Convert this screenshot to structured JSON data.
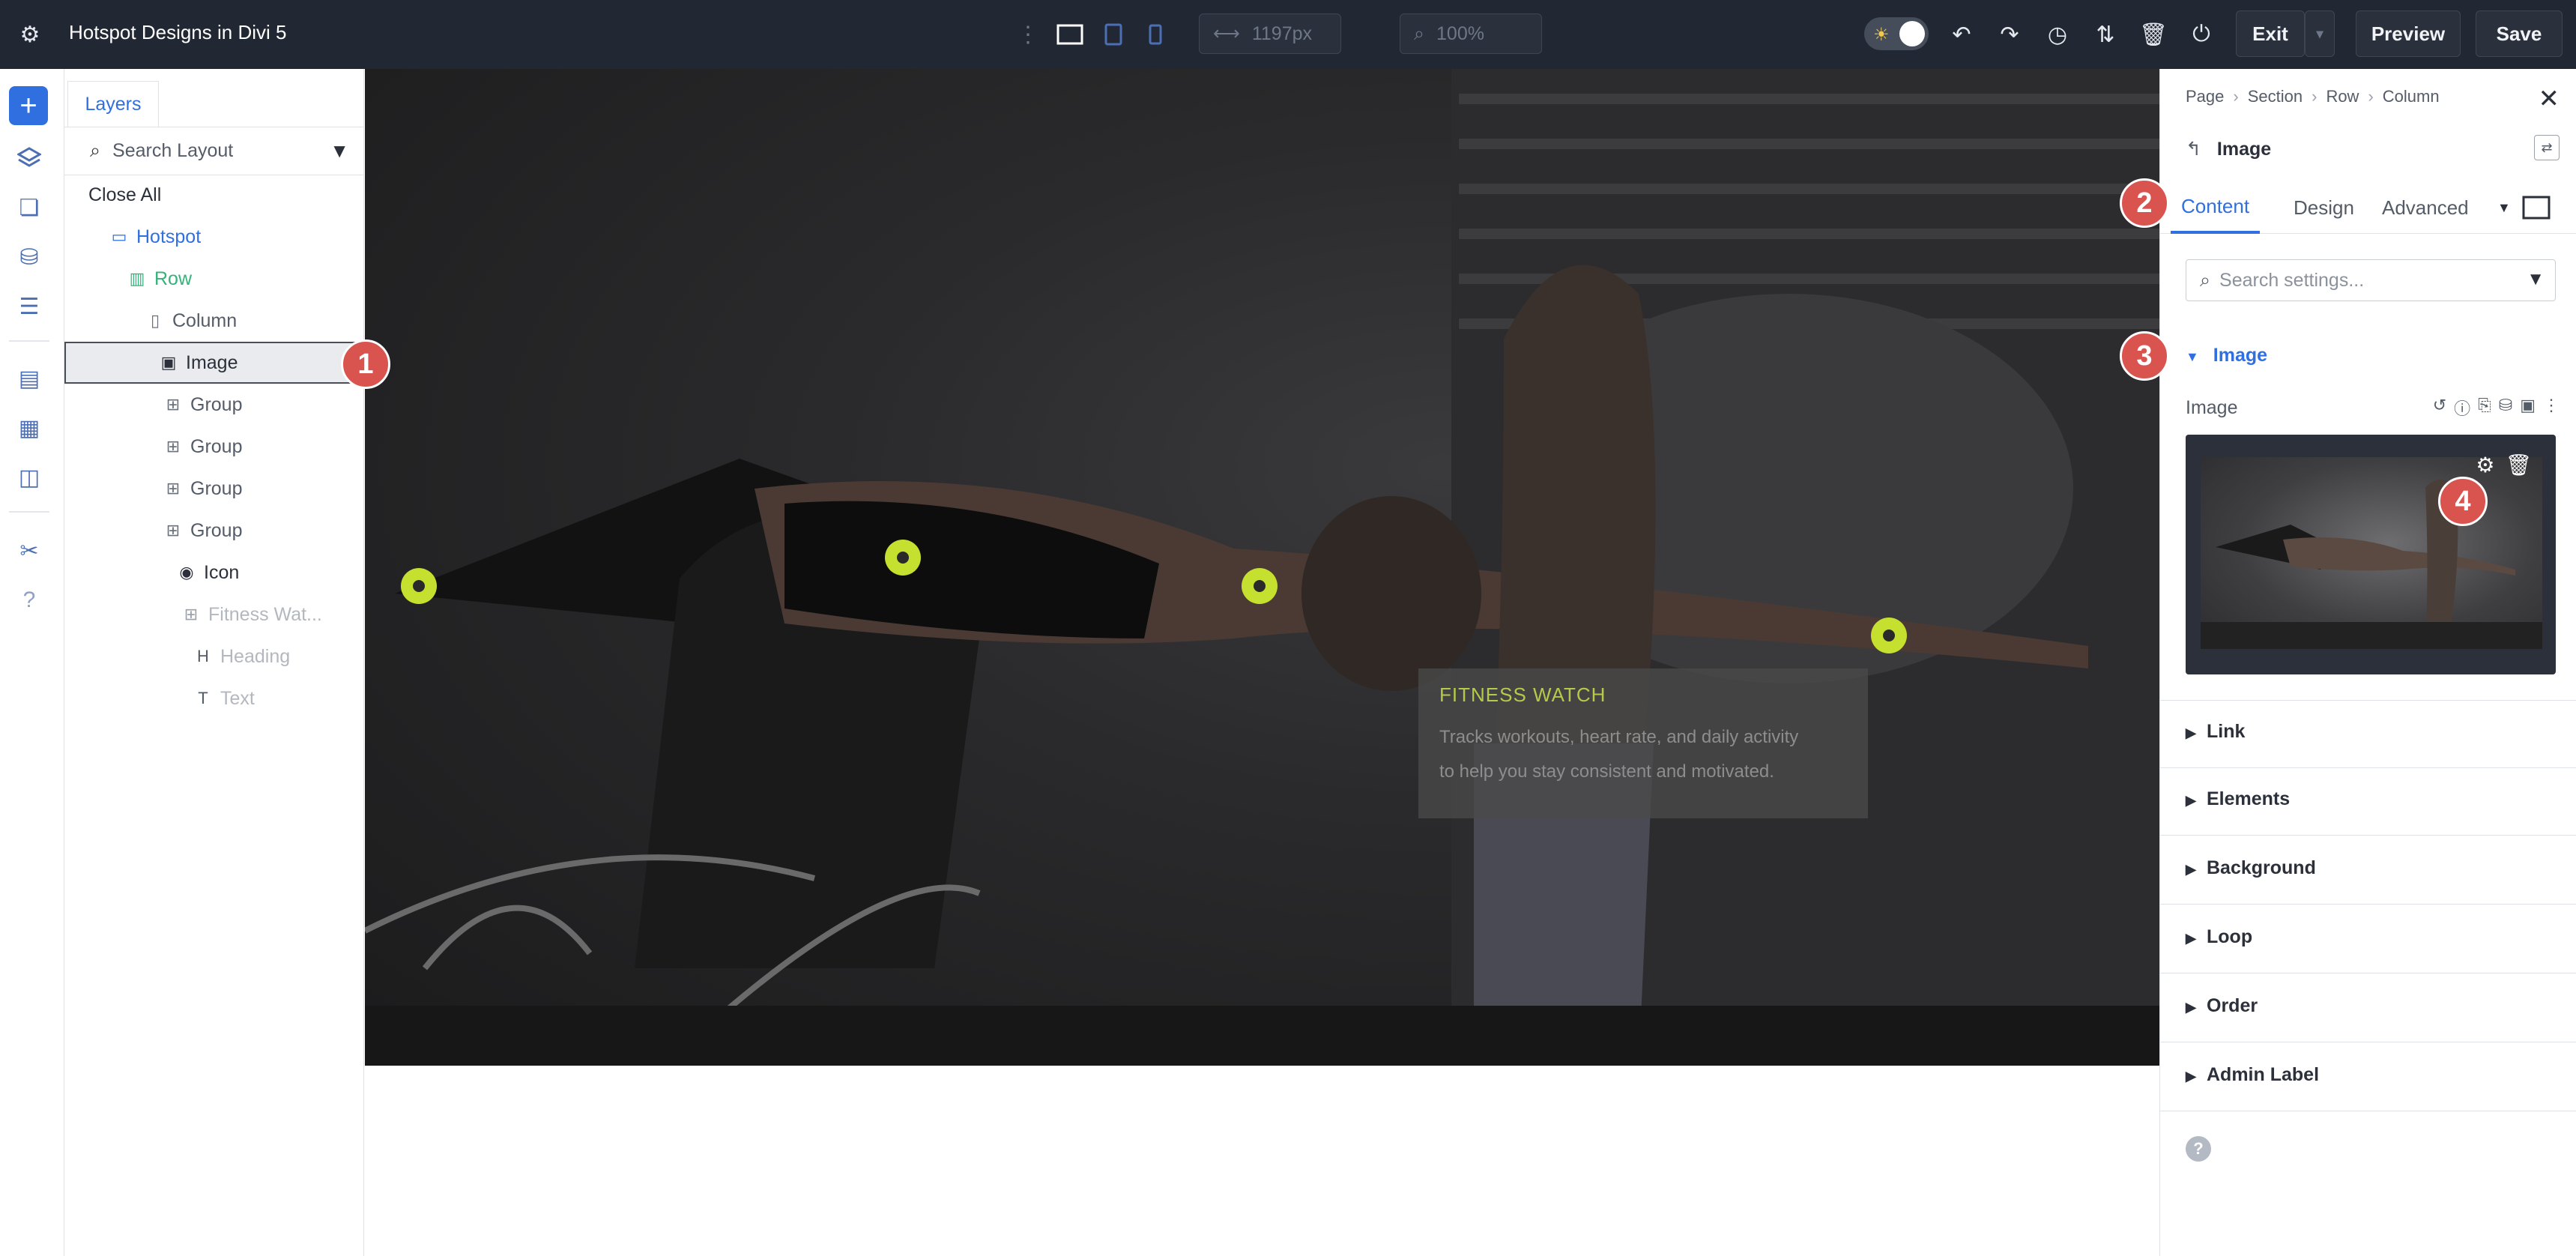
{
  "app": {
    "title": "Hotspot Designs in Divi 5"
  },
  "toolbar": {
    "width_value": "1197px",
    "zoom_value": "100%",
    "exit_label": "Exit",
    "preview_label": "Preview",
    "save_label": "Save"
  },
  "layers": {
    "tab_label": "Layers",
    "search_placeholder": "Search Layout",
    "close_all": "Close All",
    "items": [
      {
        "label": "Hotspot",
        "color": "#2f6fe0"
      },
      {
        "label": "Row",
        "color": "#34b37a"
      },
      {
        "label": "Column",
        "color": "#545c68"
      },
      {
        "label": "Image",
        "color": "#2b303a"
      },
      {
        "label": "Group",
        "color": "#545c68"
      },
      {
        "label": "Group",
        "color": "#545c68"
      },
      {
        "label": "Group",
        "color": "#545c68"
      },
      {
        "label": "Group",
        "color": "#545c68"
      },
      {
        "label": "Icon",
        "color": "#2b303a"
      },
      {
        "label": "Fitness Wat...",
        "color": "#b3b8bf"
      },
      {
        "label": "Heading",
        "color": "#b3b8bf"
      },
      {
        "label": "Text",
        "color": "#b3b8bf"
      }
    ]
  },
  "canvas": {
    "hotspot_title": "FITNESS WATCH",
    "hotspot_text_line1": "Tracks workouts, heart rate, and daily activity",
    "hotspot_text_line2": "to help you stay consistent and motivated."
  },
  "settings": {
    "breadcrumb": [
      "Page",
      "Section",
      "Row",
      "Column"
    ],
    "module_title": "Image",
    "tabs": [
      "Content",
      "Design",
      "Advanced"
    ],
    "search_placeholder": "Search settings...",
    "open_group": "Image",
    "field_label": "Image",
    "groups": [
      "Link",
      "Elements",
      "Background",
      "Loop",
      "Order",
      "Admin Label"
    ]
  },
  "badges": [
    "1",
    "2",
    "3",
    "4"
  ],
  "colors": {
    "accent": "#2f6fe0",
    "hotspot": "#c6e02f",
    "badge": "#d9534f",
    "topbar": "#222833"
  }
}
